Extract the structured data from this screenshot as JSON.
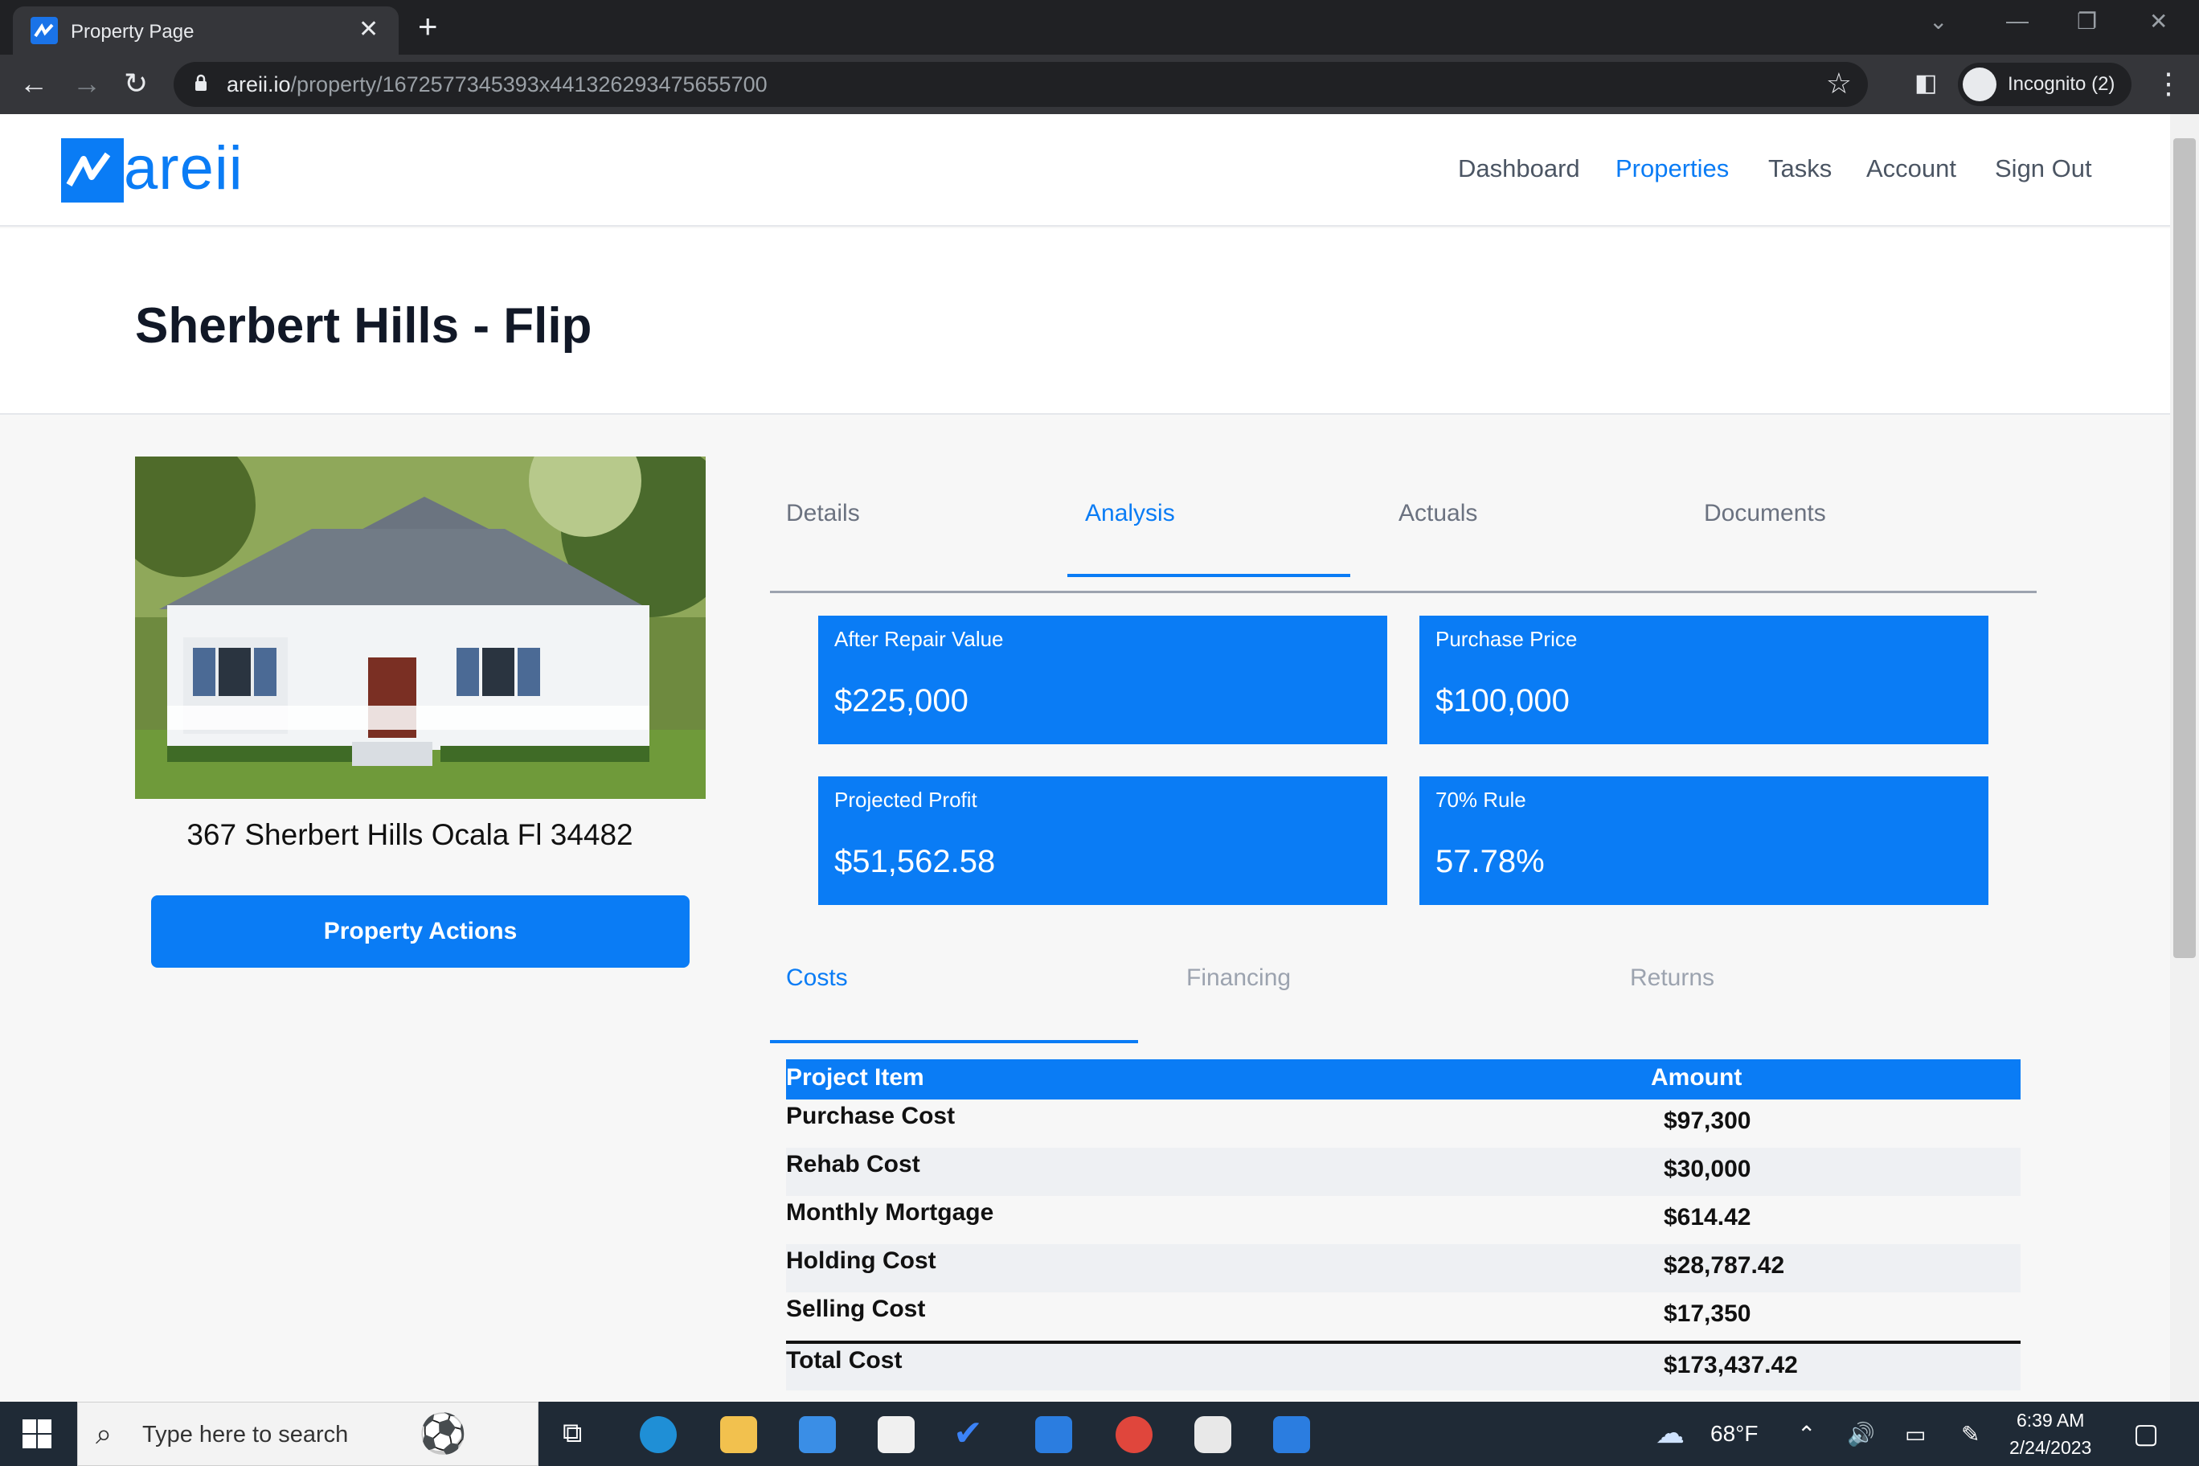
{
  "browser": {
    "tab_title": "Property Page",
    "url_host": "areii.io",
    "url_path": "/property/1672577345393x441326293475655700",
    "incognito_label": "Incognito (2)"
  },
  "header": {
    "logo_text": "areii",
    "nav": [
      "Dashboard",
      "Properties",
      "Tasks",
      "Account",
      "Sign Out"
    ],
    "active_nav": "Properties"
  },
  "property": {
    "title": "Sherbert Hills - Flip",
    "address": "367 Sherbert Hills Ocala Fl 34482",
    "actions_label": "Property Actions"
  },
  "tabs": {
    "main": [
      "Details",
      "Analysis",
      "Actuals",
      "Documents"
    ],
    "main_active": "Analysis",
    "sub": [
      "Costs",
      "Financing",
      "Returns"
    ],
    "sub_active": "Costs"
  },
  "cards": [
    {
      "label": "After Repair Value",
      "value": "$225,000"
    },
    {
      "label": "Purchase Price",
      "value": "$100,000"
    },
    {
      "label": "Projected Profit",
      "value": "$51,562.58"
    },
    {
      "label": "70% Rule",
      "value": "57.78%"
    }
  ],
  "costs_table": {
    "headers": [
      "Project Item",
      "Amount"
    ],
    "rows": [
      {
        "item": "Purchase Cost",
        "amount": "$97,300"
      },
      {
        "item": "Rehab Cost",
        "amount": "$30,000"
      },
      {
        "item": "Monthly Mortgage",
        "amount": "$614.42"
      },
      {
        "item": "Holding Cost",
        "amount": "$28,787.42"
      },
      {
        "item": "Selling Cost",
        "amount": "$17,350"
      }
    ],
    "total": {
      "item": "Total Cost",
      "amount": "$173,437.42"
    }
  },
  "taskbar": {
    "search_placeholder": "Type here to search",
    "weather": "68°F",
    "time": "6:39 AM",
    "date": "2/24/2023"
  },
  "colors": {
    "brand": "#0a7cf5",
    "header_bg": "#ffffff",
    "content_bg": "#f7f7f7"
  }
}
